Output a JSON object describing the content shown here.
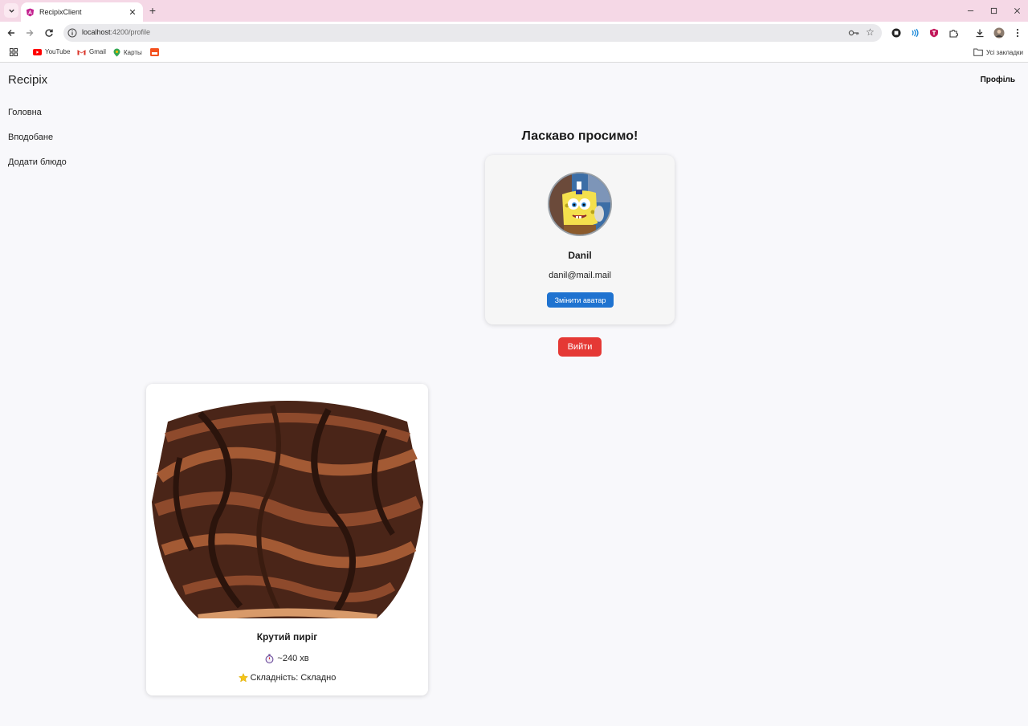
{
  "browser": {
    "tab_title": "RecipixClient",
    "url_host": "localhost",
    "url_path": ":4200/profile",
    "bookmarks": [
      {
        "label": "YouTube",
        "icon": "youtube-icon"
      },
      {
        "label": "Gmail",
        "icon": "gmail-icon"
      },
      {
        "label": "Карты",
        "icon": "maps-icon"
      },
      {
        "label": "",
        "icon": "bookmark-app-icon"
      }
    ],
    "all_bookmarks_label": "Усі закладки"
  },
  "app": {
    "title": "Recipix",
    "header_link": "Профіль",
    "nav": [
      "Головна",
      "Вподобане",
      "Додати блюдо"
    ]
  },
  "profile": {
    "welcome": "Ласкаво просимо!",
    "name": "Danil",
    "email": "danil@mail.mail",
    "change_avatar_label": "Змінити аватар",
    "logout_label": "Вийти"
  },
  "recipes": [
    {
      "title": "Крутий пиріг",
      "time": "~240 хв",
      "time_icon": "stopwatch-icon",
      "difficulty": "Складність: Складно",
      "difficulty_icon": "star-icon"
    }
  ],
  "colors": {
    "tabbar": "#f5d8e6",
    "primary_button": "#1f73d0",
    "logout_button": "#e53935",
    "page_bg": "#f8f8fb"
  }
}
